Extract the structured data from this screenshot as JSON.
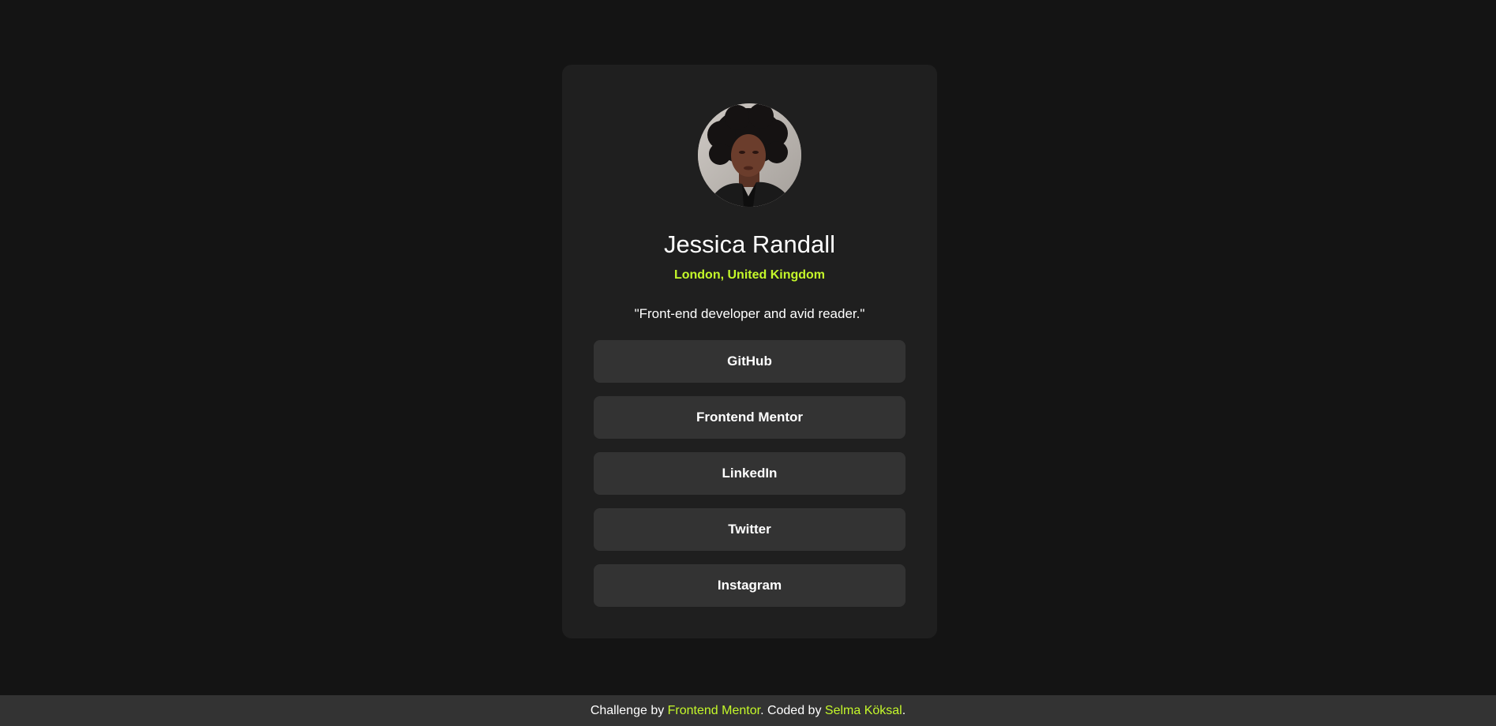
{
  "profile": {
    "name": "Jessica Randall",
    "location": "London, United Kingdom",
    "bio": "\"Front-end developer and avid reader.\""
  },
  "links": [
    {
      "label": "GitHub"
    },
    {
      "label": "Frontend Mentor"
    },
    {
      "label": "LinkedIn"
    },
    {
      "label": "Twitter"
    },
    {
      "label": "Instagram"
    }
  ],
  "footer": {
    "prefix": "Challenge by ",
    "challenge_link": "Frontend Mentor",
    "middle": ". Coded by ",
    "author_link": "Selma Köksal",
    "suffix": "."
  },
  "colors": {
    "page_background": "#141414",
    "card_background": "#1f1f1f",
    "button_background": "#333333",
    "accent": "#c4f82a",
    "text": "#ffffff"
  }
}
